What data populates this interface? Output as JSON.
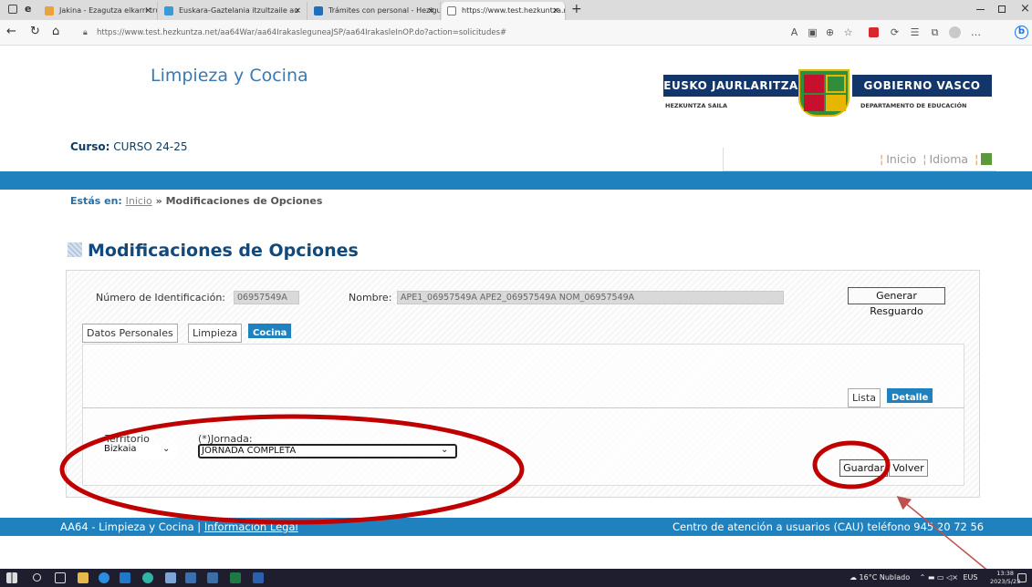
{
  "browser": {
    "tabs": [
      {
        "title": "Jakina - Ezagutza elkarri trukatzo",
        "icon_color": "#e8a33d"
      },
      {
        "title": "Euskara-Gaztelania itzultzaile au",
        "icon_color": "#3a9ad9"
      },
      {
        "title": "Trámites con personal - Heziguns",
        "icon_color": "#1f6fc0"
      },
      {
        "title": "https://www.test.hezkuntza.net/",
        "icon_color": "#777777"
      }
    ],
    "close_glyph": "×",
    "new_tab_glyph": "+",
    "url": "https://www.test.hezkuntza.net/aa64War/aa64IrakasleguneaJSP/aa64IrakasleInOP.do?action=solicitudes#"
  },
  "header": {
    "app_title": "Limpieza y Cocina",
    "logo_left": "EUSKO JAURLARITZA",
    "logo_right": "GOBIERNO VASCO",
    "logo_sub_left": "HEZKUNTZA SAILA",
    "logo_sub_right": "DEPARTAMENTO DE EDUCACIÓN",
    "curso_label": "Curso:",
    "curso_value": "CURSO 24-25",
    "link_inicio": "Inicio",
    "link_idioma": "Idioma"
  },
  "breadcrumb": {
    "label": "Estás en:",
    "home": "Inicio",
    "separator": "»",
    "current": "Modificaciones de Opciones"
  },
  "page_title": "Modificaciones de Opciones",
  "form": {
    "id_label": "Número de Identificación:",
    "id_value": "06957549A",
    "name_label": "Nombre:",
    "name_value": "APE1_06957549A APE2_06957549A NOM_06957549A",
    "generate_button": "Generar Resguardo",
    "tabs": [
      "Datos Personales",
      "Limpieza",
      "Cocina"
    ],
    "active_tab": "Cocina",
    "view_tabs": [
      "Lista",
      "Detalle"
    ],
    "active_view": "Detalle",
    "territorio_label": "Territorio",
    "territorio_value": "Bizkaia",
    "jornada_label": "(*)Jornada:",
    "jornada_value": "JORNADA COMPLETA",
    "save_button": "Guardar",
    "back_button": "Volver"
  },
  "footer": {
    "left_text": "AA64 - Limpieza y Cocina |",
    "legal_link": "Información Legal",
    "right_text": "Centro de atención a usuarios (CAU) teléfono 945 20 72 56"
  },
  "taskbar": {
    "weather": "16°C Nublado",
    "language": "EUS",
    "time": "13:38",
    "date": "2023/5/23"
  },
  "colors": {
    "accent_blue": "#1f82bf",
    "title_blue": "#12497a",
    "annotation_red": "#c00000",
    "annotation_arrow": "#c0504d"
  }
}
